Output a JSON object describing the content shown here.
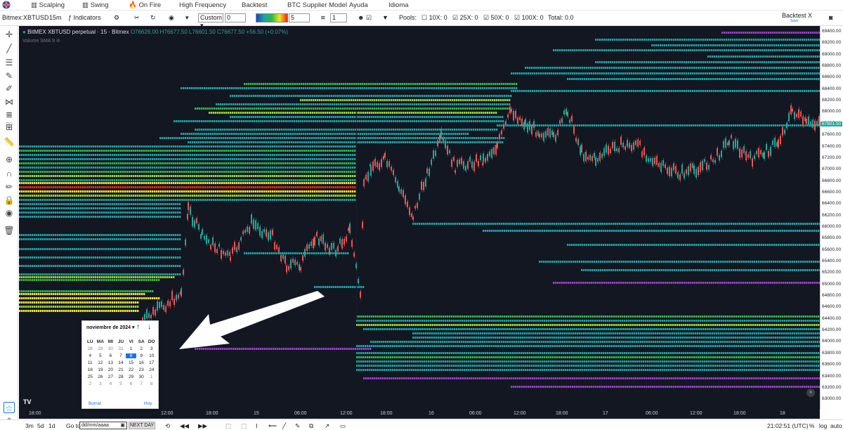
{
  "menubar": {
    "items": [
      "Scalping",
      "Swing",
      "On Fire",
      "High Frequency",
      "Backtest",
      "BTC Supplier Model",
      "Ayuda",
      "Idioma"
    ]
  },
  "toolbar": {
    "symbol": "Bitmex:XBTUSD",
    "interval": "15m",
    "indicators": "Indicators",
    "preset": "Custom",
    "value1": "0",
    "value2": "5",
    "value3": "1",
    "pools_label": "Pools:",
    "pools": [
      "10X: 0",
      "25X: 0",
      "50X: 0",
      "100X: 0"
    ],
    "pools_checked": [
      false,
      true,
      true,
      true
    ],
    "total": "Total: 0.0",
    "backtest": "Backtest X",
    "save": "Save"
  },
  "legend": {
    "title": "BitMEX XBTUSD perpetual · 15 · Bitmex",
    "ohlc": "O76626.00 H76677.50 L76601.50 C76677.50 +56.50 (+0.07%)",
    "volume": "Volume SMA 9"
  },
  "yaxis": {
    "labels": [
      "69400.00",
      "69200.00",
      "69000.00",
      "68800.00",
      "68600.00",
      "68400.00",
      "68200.00",
      "68000.00",
      "67800.00",
      "67600.00",
      "67400.00",
      "67200.00",
      "67000.00",
      "66800.00",
      "66600.00",
      "66400.00",
      "66200.00",
      "66000.00",
      "65800.00",
      "65600.00",
      "65400.00",
      "65200.00",
      "65000.00",
      "64800.00",
      "64600.00",
      "64400.00",
      "64200.00",
      "64000.00",
      "63800.00",
      "63600.00",
      "63400.00",
      "63200.00",
      "63000.00"
    ],
    "current_price": "67801.50"
  },
  "xaxis": {
    "labels": [
      "18:00",
      "12:00",
      "18:00",
      "15",
      "06:00",
      "12:00",
      "18:00",
      "16",
      "06:00",
      "12:00",
      "18:00",
      "17",
      "06:00",
      "12:00",
      "18:00",
      "18"
    ]
  },
  "datepicker": {
    "month": "noviembre de 2024",
    "weekdays": [
      "LU",
      "MA",
      "MI",
      "JU",
      "VI",
      "SA",
      "DO"
    ],
    "weeks": [
      [
        "28",
        "29",
        "30",
        "31",
        "1",
        "2",
        "3"
      ],
      [
        "4",
        "5",
        "6",
        "7",
        "8",
        "9",
        "10"
      ],
      [
        "11",
        "12",
        "13",
        "14",
        "15",
        "16",
        "17"
      ],
      [
        "18",
        "19",
        "20",
        "21",
        "22",
        "23",
        "24"
      ],
      [
        "25",
        "26",
        "27",
        "28",
        "29",
        "30",
        "1"
      ],
      [
        "2",
        "3",
        "4",
        "5",
        "6",
        "7",
        "8"
      ]
    ],
    "selected": "8",
    "clear": "Borrar",
    "today": "Hoy"
  },
  "bottombar": {
    "ranges": [
      "3m",
      "5d",
      "1d"
    ],
    "goto": "Go to",
    "date_placeholder": "dd/mm/aaaa",
    "next_day": "NEXT DAY",
    "clock": "21:02:51 (UTC)",
    "percent": "%",
    "log": "log",
    "auto": "auto"
  },
  "colors": {
    "chart_bg": "#131722",
    "teal": "#1aa3a3",
    "green": "#2fb84a",
    "lime": "#9bd62b",
    "yellow": "#f2e61e",
    "red": "#e8241e",
    "purple": "#9a3fc9",
    "candle_up": "#26a69a",
    "candle_down": "#ef5350"
  }
}
